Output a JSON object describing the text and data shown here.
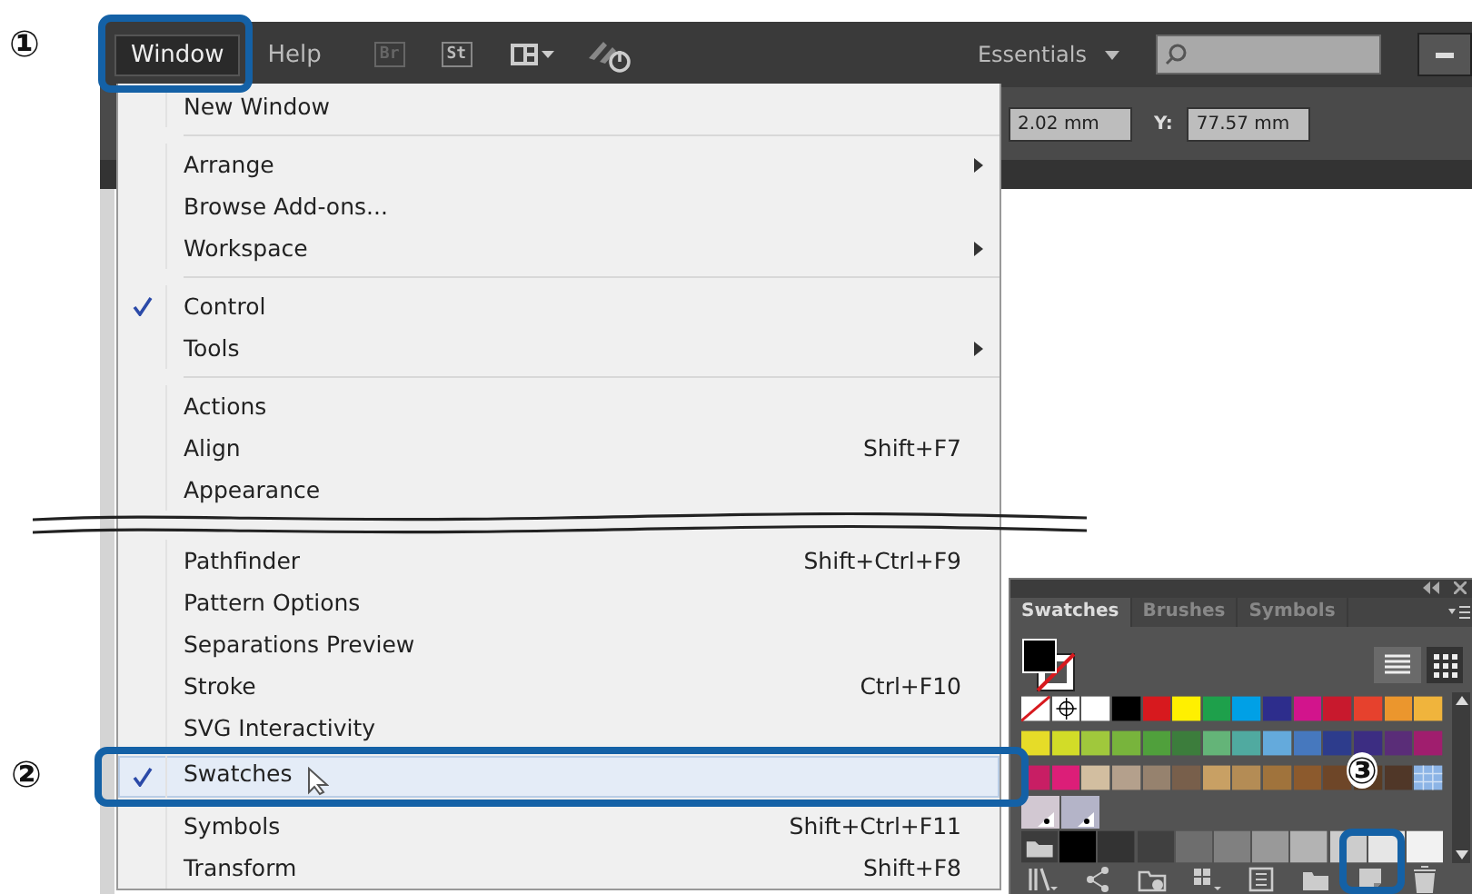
{
  "callouts": [
    "①",
    "②",
    "③"
  ],
  "menu_bar": {
    "items": [
      {
        "label": "Window",
        "selected": true
      },
      {
        "label": "Help",
        "selected": false
      }
    ],
    "app_icons": [
      "Br",
      "St"
    ],
    "workspace": "Essentials"
  },
  "control_bar": {
    "x_value": "2.02 mm",
    "y_label": "Y:",
    "y_value": "77.57 mm"
  },
  "menu": {
    "groups": [
      {
        "kind": "group",
        "items": [
          {
            "label": "New Window",
            "checked": false,
            "submenu": false,
            "selected": false
          }
        ]
      },
      {
        "kind": "separator"
      },
      {
        "kind": "group",
        "items": [
          {
            "label": "Arrange",
            "checked": false,
            "submenu": true,
            "selected": false
          },
          {
            "label": "Browse Add-ons...",
            "checked": false,
            "submenu": false,
            "selected": false
          },
          {
            "label": "Workspace",
            "checked": false,
            "submenu": true,
            "selected": false
          }
        ]
      },
      {
        "kind": "separator"
      },
      {
        "kind": "group",
        "items": [
          {
            "label": "Control",
            "checked": true,
            "submenu": false,
            "selected": false
          },
          {
            "label": "Tools",
            "checked": false,
            "submenu": true,
            "selected": false
          }
        ]
      },
      {
        "kind": "separator"
      },
      {
        "kind": "group",
        "items": [
          {
            "label": "Actions",
            "checked": false,
            "submenu": false,
            "selected": false
          },
          {
            "label": "Align",
            "shortcut": "Shift+F7",
            "checked": false,
            "submenu": false,
            "selected": false
          },
          {
            "label": "Appearance",
            "checked": false,
            "submenu": false,
            "selected": false
          }
        ]
      },
      {
        "kind": "break"
      },
      {
        "kind": "group",
        "items": [
          {
            "label": "Pathfinder",
            "shortcut": "Shift+Ctrl+F9",
            "checked": false,
            "submenu": false,
            "selected": false
          },
          {
            "label": "Pattern Options",
            "checked": false,
            "submenu": false,
            "selected": false
          },
          {
            "label": "Separations Preview",
            "checked": false,
            "submenu": false,
            "selected": false
          },
          {
            "label": "Stroke",
            "shortcut": "Ctrl+F10",
            "checked": false,
            "submenu": false,
            "selected": false
          },
          {
            "label": "SVG Interactivity",
            "checked": false,
            "submenu": false,
            "selected": false
          },
          {
            "label": "Swatches",
            "checked": true,
            "submenu": false,
            "selected": true
          },
          {
            "label": "Symbols",
            "shortcut": "Shift+Ctrl+F11",
            "checked": false,
            "submenu": false,
            "selected": false
          },
          {
            "label": "Transform",
            "shortcut": "Shift+F8",
            "checked": false,
            "submenu": false,
            "selected": false
          }
        ]
      }
    ]
  },
  "swatches_panel": {
    "tabs": [
      {
        "label": "Swatches",
        "selected": true
      },
      {
        "label": "Brushes",
        "selected": false
      },
      {
        "label": "Symbols",
        "selected": false
      }
    ],
    "rows": [
      [
        {
          "kind": "none",
          "color": "#ffffff"
        },
        {
          "kind": "registration",
          "color": "#ffffff"
        },
        {
          "kind": "color",
          "color": "#ffffff"
        },
        {
          "kind": "color",
          "color": "#000000"
        },
        {
          "kind": "color",
          "color": "#d7191e"
        },
        {
          "kind": "color",
          "color": "#fff000"
        },
        {
          "kind": "color",
          "color": "#1ea04b"
        },
        {
          "kind": "color",
          "color": "#00a0e6"
        },
        {
          "kind": "color",
          "color": "#2d2d8c"
        },
        {
          "kind": "color",
          "color": "#d2148c"
        },
        {
          "kind": "color",
          "color": "#c8192d"
        },
        {
          "kind": "color",
          "color": "#e6412d"
        },
        {
          "kind": "color",
          "color": "#eb962d"
        },
        {
          "kind": "color",
          "color": "#f0b43c"
        }
      ],
      [
        {
          "kind": "color",
          "color": "#e6dc28"
        },
        {
          "kind": "color",
          "color": "#d2dc28"
        },
        {
          "kind": "color",
          "color": "#a0c83c"
        },
        {
          "kind": "color",
          "color": "#78b43c"
        },
        {
          "kind": "color",
          "color": "#50a03c"
        },
        {
          "kind": "color",
          "color": "#3c7d3c"
        },
        {
          "kind": "color",
          "color": "#64b478"
        },
        {
          "kind": "color",
          "color": "#50aaa0"
        },
        {
          "kind": "color",
          "color": "#64aadc"
        },
        {
          "kind": "color",
          "color": "#4678be"
        },
        {
          "kind": "color",
          "color": "#2d3c8c"
        },
        {
          "kind": "color",
          "color": "#3c2d82"
        },
        {
          "kind": "color",
          "color": "#5a2d78"
        },
        {
          "kind": "color",
          "color": "#a01e6e"
        }
      ],
      [
        {
          "kind": "color",
          "color": "#c81e64"
        },
        {
          "kind": "color",
          "color": "#dc1e78"
        },
        {
          "kind": "color",
          "color": "#d2bea0"
        },
        {
          "kind": "color",
          "color": "#b4a08c"
        },
        {
          "kind": "color",
          "color": "#96826e"
        },
        {
          "kind": "color",
          "color": "#785f4b"
        },
        {
          "kind": "color",
          "color": "#c8a064"
        },
        {
          "kind": "color",
          "color": "#b48c55"
        },
        {
          "kind": "color",
          "color": "#a0733c"
        },
        {
          "kind": "color",
          "color": "#8c5a2d"
        },
        {
          "kind": "color",
          "color": "#6e4628"
        },
        {
          "kind": "color",
          "color": "#5a3c23"
        },
        {
          "kind": "color",
          "color": "#503728"
        },
        {
          "kind": "pattern",
          "color": "#8cb4e6"
        }
      ],
      [
        {
          "kind": "gradient",
          "color": "#d2c8d2"
        },
        {
          "kind": "gradient",
          "color": "#b4b4c8"
        }
      ],
      [
        {
          "kind": "folder",
          "color": "#3c3c3c"
        },
        {
          "kind": "color",
          "color": "#000000"
        },
        {
          "kind": "color",
          "color": "#333333"
        },
        {
          "kind": "color",
          "color": "#404040"
        },
        {
          "kind": "color",
          "color": "#6e6e6e"
        },
        {
          "kind": "color",
          "color": "#808080"
        },
        {
          "kind": "color",
          "color": "#999999"
        },
        {
          "kind": "color",
          "color": "#b3b3b3"
        },
        {
          "kind": "color",
          "color": "#cccccc"
        },
        {
          "kind": "color",
          "color": "#e6e6e6"
        },
        {
          "kind": "color",
          "color": "#f2f2f2"
        }
      ]
    ]
  }
}
